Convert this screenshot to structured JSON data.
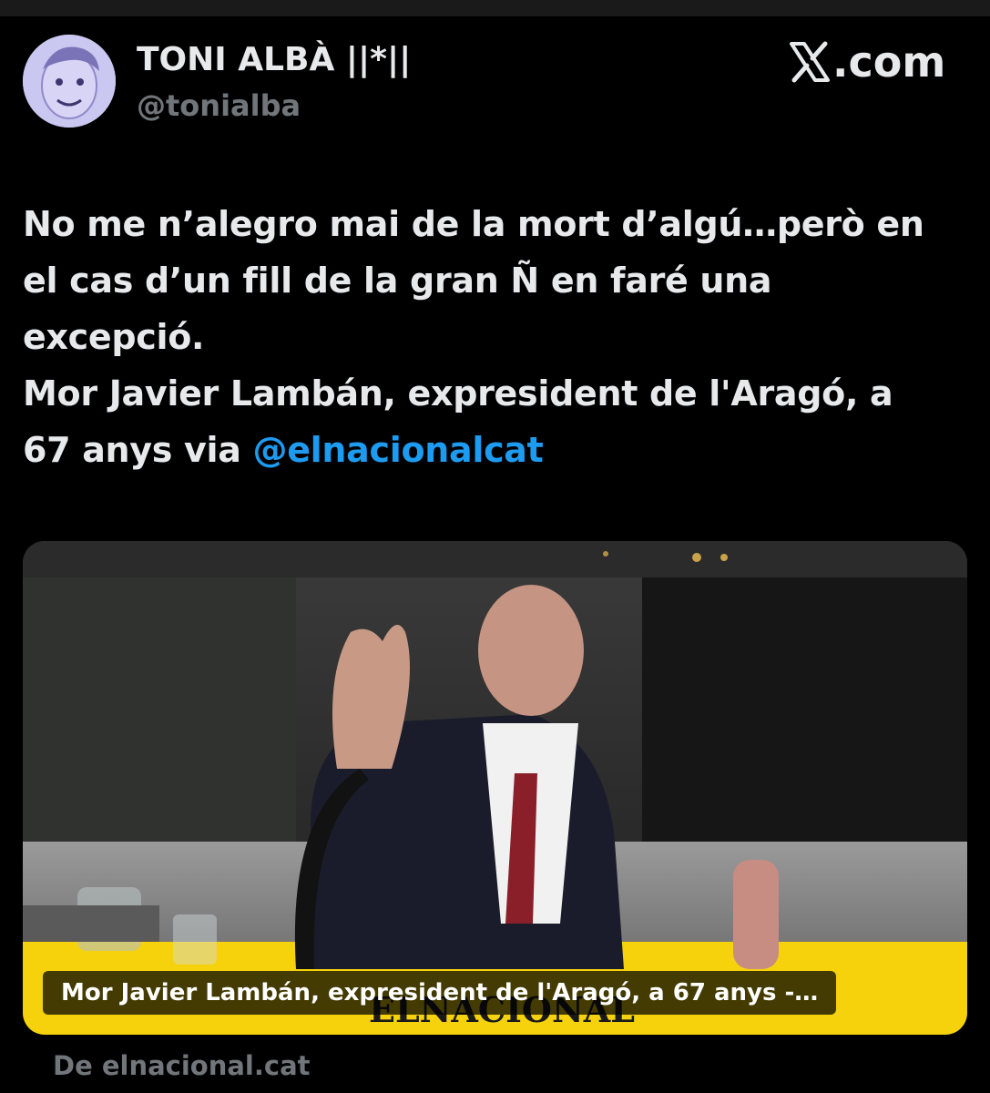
{
  "author": {
    "display_name": "TONI ALBÀ ||*||",
    "handle": "@tonialba"
  },
  "brand": {
    "site": ".com",
    "logo_icon": "x-logo-icon"
  },
  "tweet": {
    "lines": [
      "No me n’alegro mai de la mort d’algú…però en",
      "el cas d’un fill de la gran Ñ en faré una",
      "excepció.",
      "Mor Javier Lambán, expresident de l'Aragó, a"
    ],
    "last_line_prefix": "67 anys via ",
    "mention": "@elnacionalcat"
  },
  "link_card": {
    "title": "Mor Javier Lambán, expresident de l'Aragó, a 67 anys -…",
    "watermark": "ELNACIONAL",
    "image_icon": "news-photo"
  },
  "source_label": "De elnacional.cat",
  "colors": {
    "background": "#000000",
    "text_primary": "#e7e9ea",
    "text_secondary": "#71767b",
    "link": "#1d9bf0",
    "card_banner": "#f5d20b"
  }
}
